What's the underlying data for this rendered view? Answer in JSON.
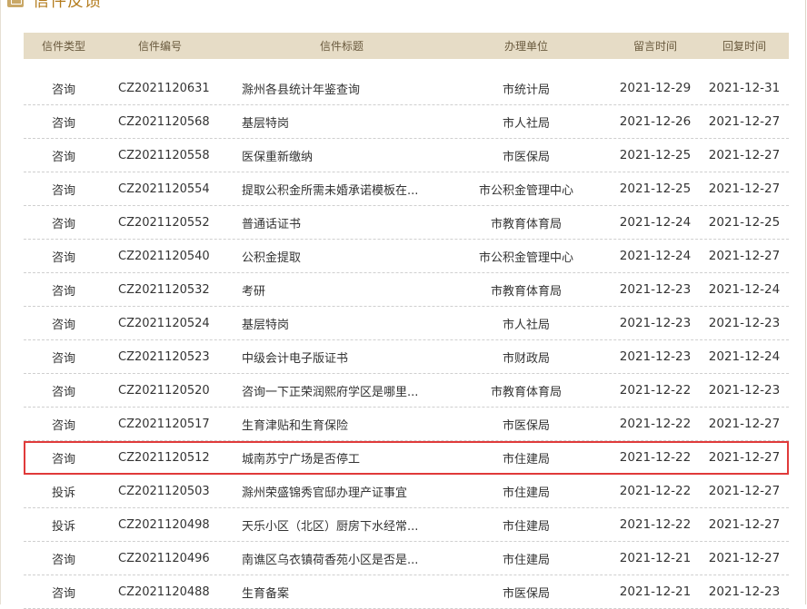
{
  "heading": {
    "title": "信件反馈",
    "icon": "mail-icon"
  },
  "columns": [
    "信件类型",
    "信件编号",
    "信件标题",
    "办理单位",
    "留言时间",
    "回复时间"
  ],
  "highlight_color": "#e03a3a",
  "rows": [
    {
      "type": "咨询",
      "num": "CZ2021120631",
      "title": "滁州各县统计年鉴查询",
      "dept": "市统计局",
      "msg": "2021-12-29",
      "rep": "2021-12-31"
    },
    {
      "type": "咨询",
      "num": "CZ2021120568",
      "title": "基层特岗",
      "dept": "市人社局",
      "msg": "2021-12-26",
      "rep": "2021-12-27"
    },
    {
      "type": "咨询",
      "num": "CZ2021120558",
      "title": "医保重新缴纳",
      "dept": "市医保局",
      "msg": "2021-12-25",
      "rep": "2021-12-27"
    },
    {
      "type": "咨询",
      "num": "CZ2021120554",
      "title": "提取公积金所需未婚承诺模板在...",
      "dept": "市公积金管理中心",
      "msg": "2021-12-25",
      "rep": "2021-12-27"
    },
    {
      "type": "咨询",
      "num": "CZ2021120552",
      "title": "普通话证书",
      "dept": "市教育体育局",
      "msg": "2021-12-24",
      "rep": "2021-12-25"
    },
    {
      "type": "咨询",
      "num": "CZ2021120540",
      "title": "公积金提取",
      "dept": "市公积金管理中心",
      "msg": "2021-12-24",
      "rep": "2021-12-27"
    },
    {
      "type": "咨询",
      "num": "CZ2021120532",
      "title": "考研",
      "dept": "市教育体育局",
      "msg": "2021-12-23",
      "rep": "2021-12-24"
    },
    {
      "type": "咨询",
      "num": "CZ2021120524",
      "title": "基层特岗",
      "dept": "市人社局",
      "msg": "2021-12-23",
      "rep": "2021-12-23"
    },
    {
      "type": "咨询",
      "num": "CZ2021120523",
      "title": "中级会计电子版证书",
      "dept": "市财政局",
      "msg": "2021-12-23",
      "rep": "2021-12-24"
    },
    {
      "type": "咨询",
      "num": "CZ2021120520",
      "title": "咨询一下正荣润熙府学区是哪里...",
      "dept": "市教育体育局",
      "msg": "2021-12-22",
      "rep": "2021-12-23"
    },
    {
      "type": "咨询",
      "num": "CZ2021120517",
      "title": "生育津贴和生育保险",
      "dept": "市医保局",
      "msg": "2021-12-22",
      "rep": "2021-12-27"
    },
    {
      "type": "咨询",
      "num": "CZ2021120512",
      "title": "城南苏宁广场是否停工",
      "dept": "市住建局",
      "msg": "2021-12-22",
      "rep": "2021-12-27",
      "highlighted": true
    },
    {
      "type": "投诉",
      "num": "CZ2021120503",
      "title": "滁州荣盛锦秀官邸办理产证事宜",
      "dept": "市住建局",
      "msg": "2021-12-22",
      "rep": "2021-12-27"
    },
    {
      "type": "投诉",
      "num": "CZ2021120498",
      "title": "天乐小区（北区）厨房下水经常...",
      "dept": "市住建局",
      "msg": "2021-12-22",
      "rep": "2021-12-27"
    },
    {
      "type": "咨询",
      "num": "CZ2021120496",
      "title": "南谯区乌衣镇荷香苑小区是否是...",
      "dept": "市住建局",
      "msg": "2021-12-21",
      "rep": "2021-12-27"
    },
    {
      "type": "咨询",
      "num": "CZ2021120488",
      "title": "生育备案",
      "dept": "市医保局",
      "msg": "2021-12-21",
      "rep": "2021-12-23"
    }
  ]
}
